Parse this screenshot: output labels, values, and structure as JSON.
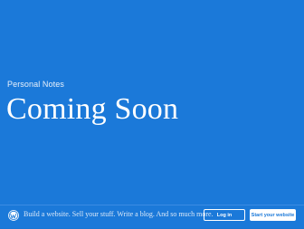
{
  "site": {
    "title": "Personal Notes",
    "headline": "Coming Soon"
  },
  "footer": {
    "logo_icon": "wordpress-logo-icon",
    "tagline": "Build a website. Sell your stuff. Write a blog. And so much more.",
    "login_label": "Log in",
    "start_label": "Start your website"
  },
  "colors": {
    "background": "#1b79d9",
    "text": "#ffffff",
    "button_primary_text": "#1b79d9"
  }
}
